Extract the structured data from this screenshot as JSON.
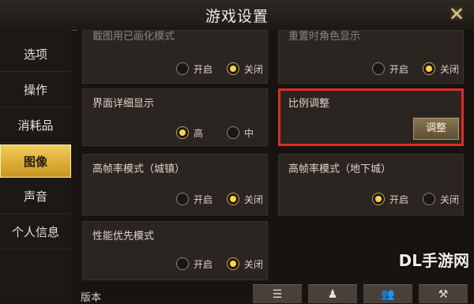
{
  "window": {
    "title": "游戏设置"
  },
  "sidebar": {
    "items": [
      {
        "label": "选项"
      },
      {
        "label": "操作"
      },
      {
        "label": "消耗品"
      },
      {
        "label": "图像",
        "active": true
      },
      {
        "label": "声音"
      },
      {
        "label": "个人信息"
      }
    ]
  },
  "settings": {
    "top_left": {
      "label": "截图用已画化模式",
      "opt1": "开启",
      "opt2": "关闭",
      "selected": "关闭"
    },
    "top_right": {
      "label": "重置时角色显示",
      "opt1": "开启",
      "opt2": "关闭",
      "selected": "关闭"
    },
    "detail_display": {
      "label": "界面详细显示",
      "opt1": "高",
      "opt2": "中",
      "selected": "高"
    },
    "scale_adjust": {
      "label": "比例调整",
      "button": "调整"
    },
    "hfr_town": {
      "label": "高帧率模式（城镇）",
      "opt1": "开启",
      "opt2": "关闭",
      "selected": "关闭"
    },
    "hfr_dungeon": {
      "label": "高帧率模式（地下城）",
      "opt1": "开启",
      "opt2": "关闭",
      "selected": "开启"
    },
    "performance": {
      "label": "性能优先模式",
      "opt1": "开启",
      "opt2": "关闭",
      "selected": "关闭"
    }
  },
  "footer": {
    "version_label": "版本"
  },
  "bottom_icons": [
    "list-icon",
    "character-icon",
    "group-icon",
    "tool-icon"
  ],
  "watermark": "DL手游网",
  "colors": {
    "accent": "#f2cc5a",
    "highlight_border": "#e02b2b"
  }
}
